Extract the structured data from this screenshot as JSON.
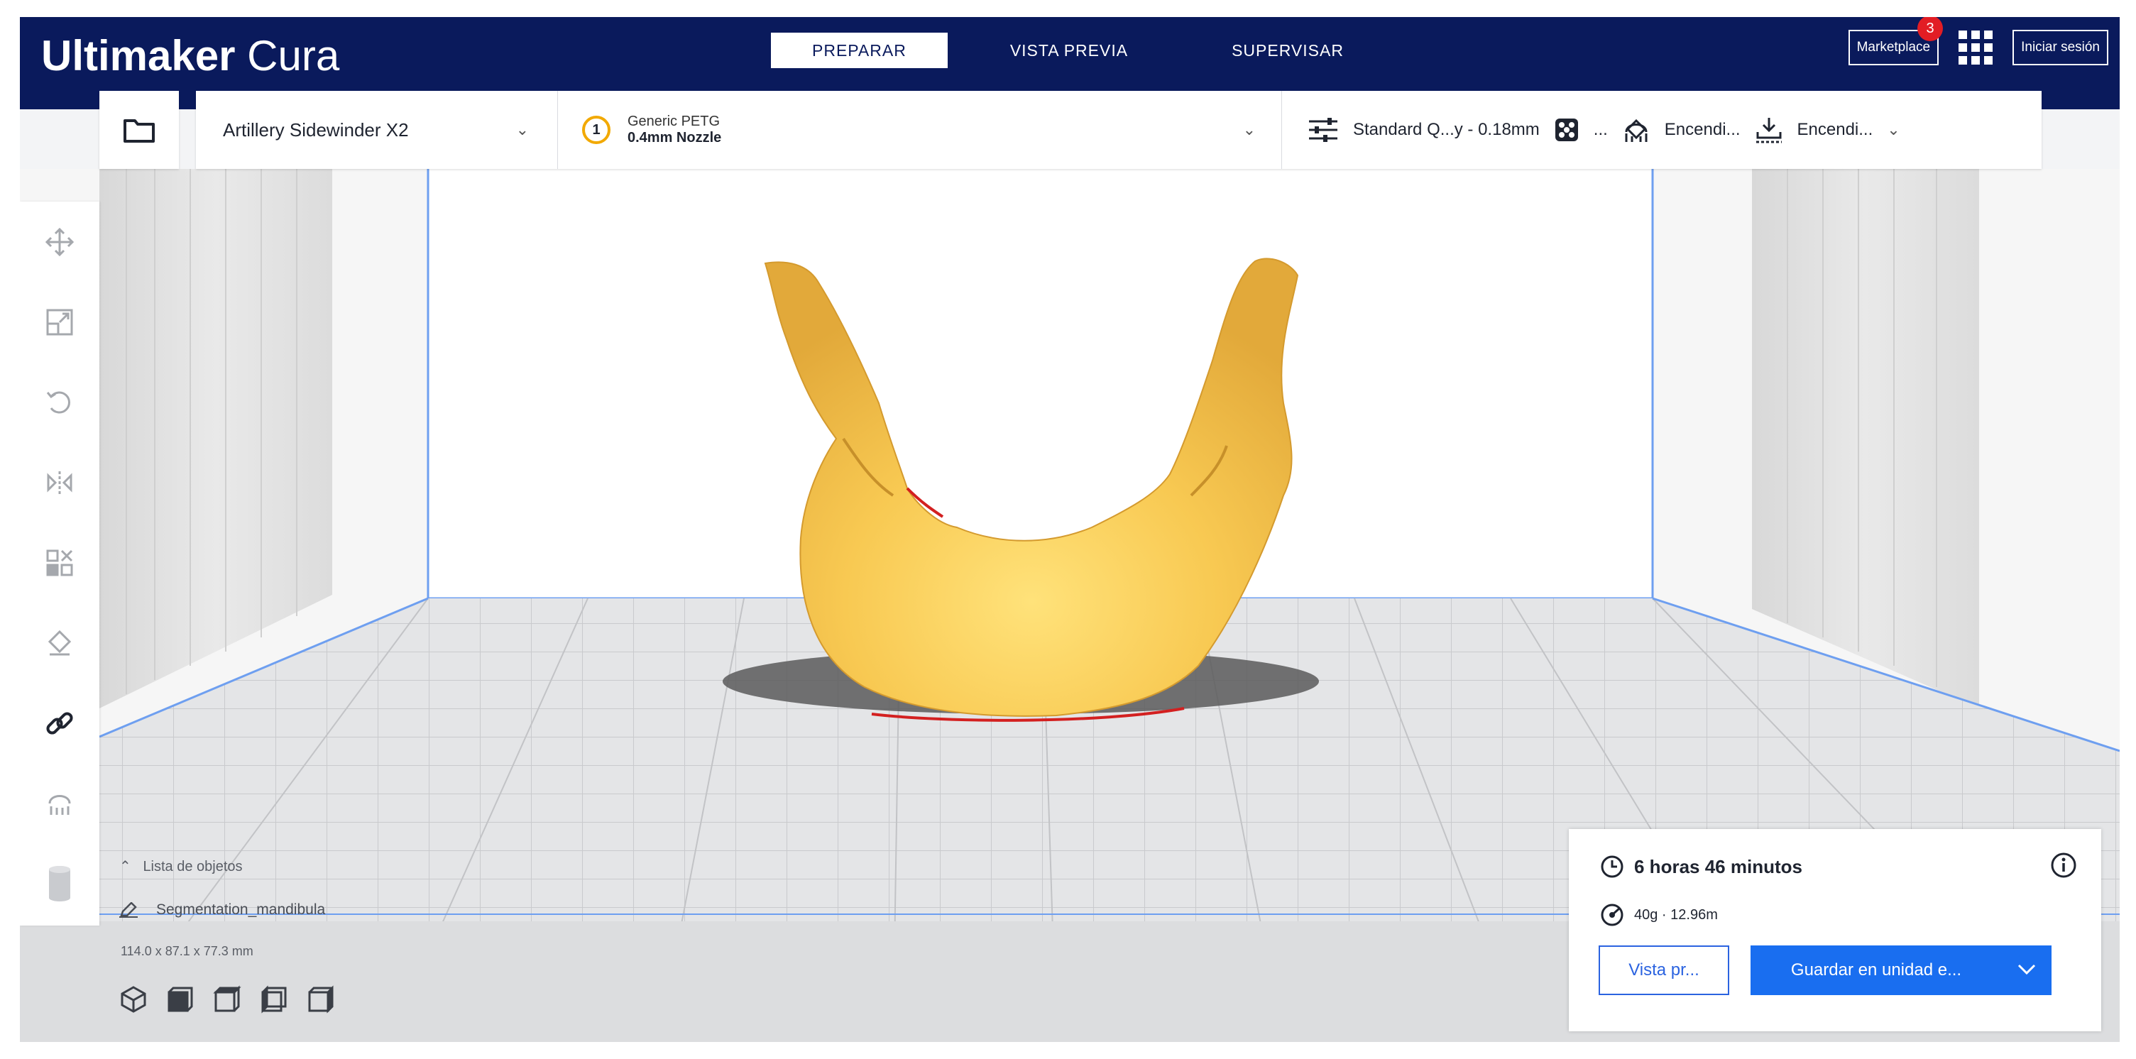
{
  "header": {
    "app_name_bold": "Ultimaker",
    "app_name_light": "Cura",
    "stages": [
      "PREPARAR",
      "VISTA PREVIA",
      "SUPERVISAR"
    ],
    "active_stage": "PREPARAR",
    "marketplace_label": "Marketplace",
    "marketplace_badge": "3",
    "signin_label": "Iniciar sesión"
  },
  "toolbar": {
    "printer": "Artillery Sidewinder X2",
    "extruder_number": "1",
    "material": "Generic PETG",
    "nozzle": "0.4mm Nozzle",
    "profile": "Standard Q...y - 0.18mm",
    "infill": "...",
    "support": "Encendi...",
    "adhesion": "Encendi..."
  },
  "left_tools": [
    "move-icon",
    "scale-icon",
    "rotate-icon",
    "mirror-icon",
    "per-model-settings-icon",
    "support-blocker-icon",
    "link-icon",
    "custom-support-icon",
    "cylinder-icon"
  ],
  "object_list": {
    "toggle_label": "Lista de objetos",
    "object_name": "Segmentation_mandibula",
    "dimensions": "114.0 x 87.1 x 77.3 mm"
  },
  "view_buttons": [
    "3d-view-icon",
    "front-view-icon",
    "top-view-icon",
    "left-view-icon",
    "right-view-icon"
  ],
  "print_panel": {
    "time": "6 horas 46 minutos",
    "material_usage": "40g · 12.96m",
    "preview_button": "Vista pr...",
    "save_button": "Guardar en unidad e..."
  },
  "colors": {
    "header_bg": "#0a1a5c",
    "model_color": "#f6c34f",
    "accent_blue": "#196ef0",
    "badge_red": "#e21d24"
  }
}
